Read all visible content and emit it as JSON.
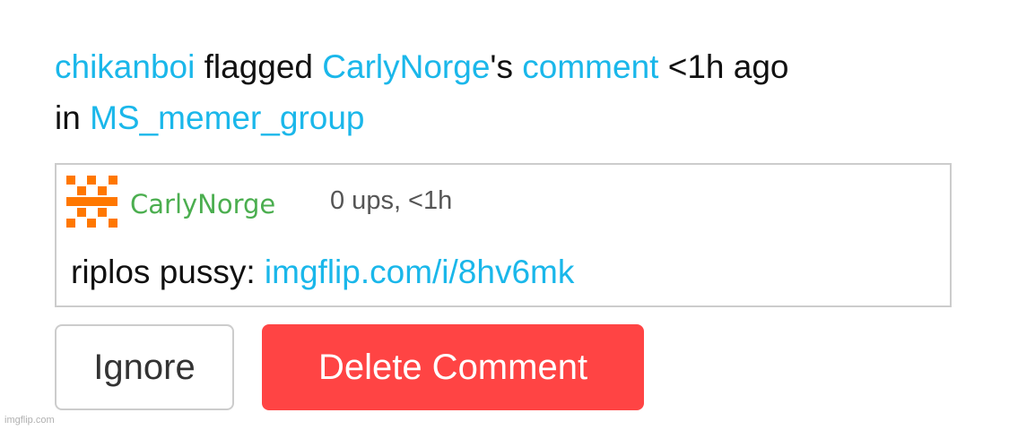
{
  "notification": {
    "actor": "chikanboi",
    "action": "flagged",
    "target_user": "CarlyNorge",
    "possessive": "'s",
    "object": "comment",
    "time": "<1h ago",
    "in_word": "in",
    "group": "MS_memer_group"
  },
  "comment": {
    "username": "CarlyNorge",
    "meta": "0 ups, <1h",
    "text": "riplos pussy:",
    "link": "imgflip.com/i/8hv6mk",
    "avatar_icon": "orange-pixel-identicon"
  },
  "buttons": {
    "ignore": "Ignore",
    "delete": "Delete Comment"
  },
  "watermark": "imgflip.com",
  "colors": {
    "link": "#1ab7ea",
    "username_green": "#4bae4f",
    "delete_red": "#ff4444",
    "avatar_orange": "#ff7700",
    "border_gray": "#cccccc"
  }
}
